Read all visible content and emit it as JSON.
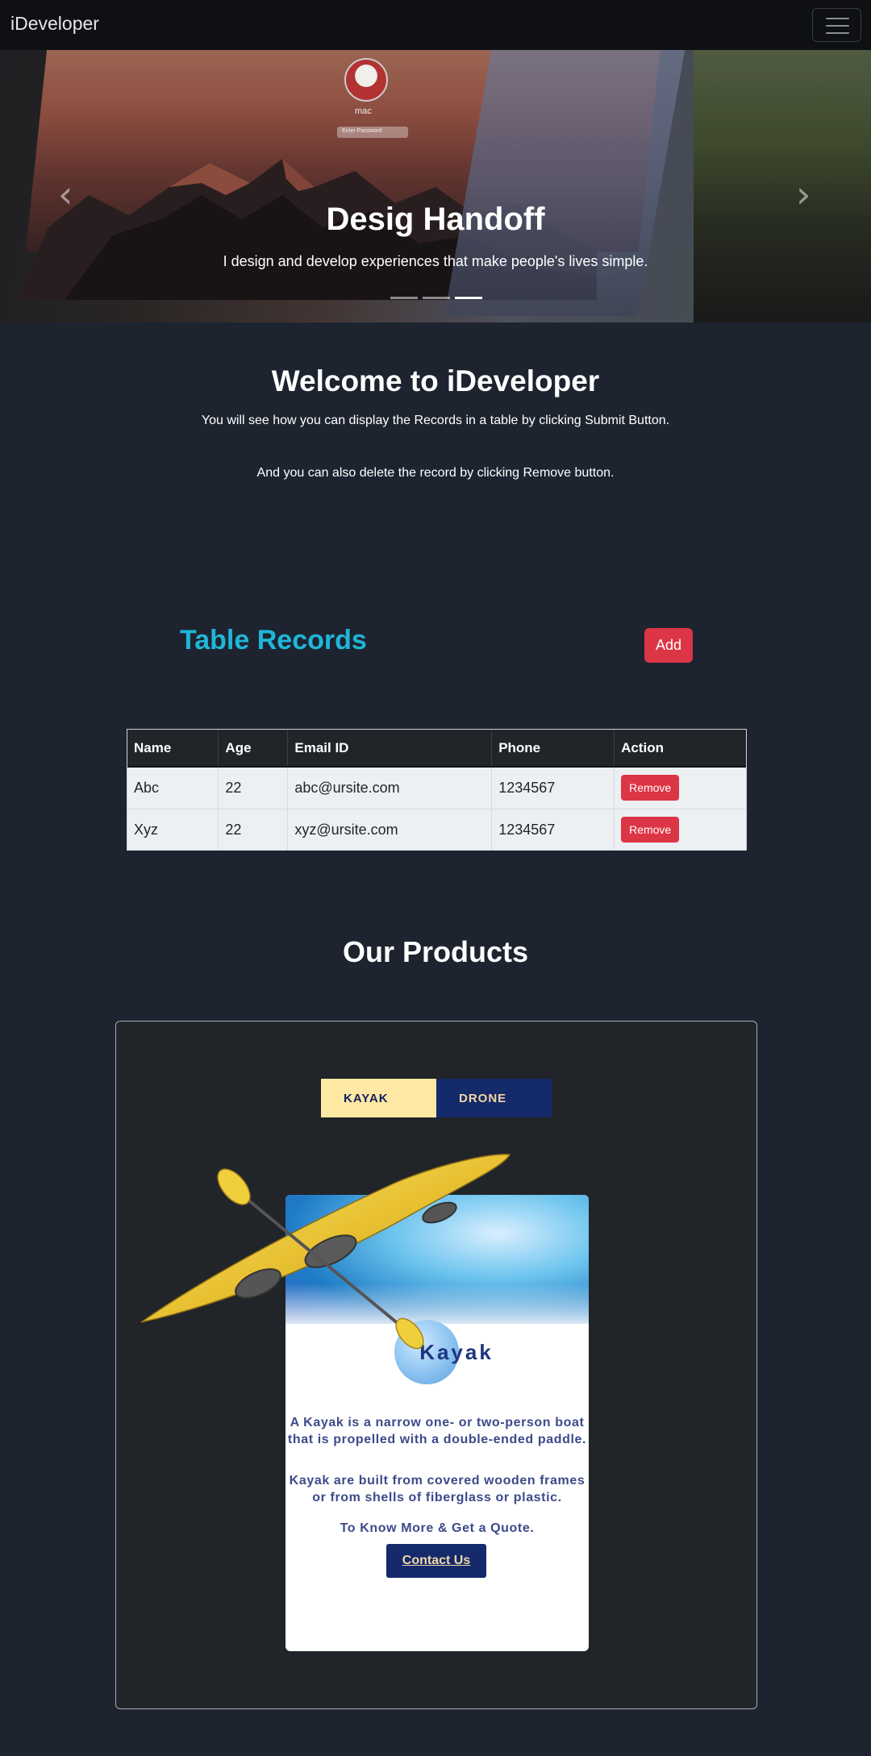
{
  "navbar": {
    "brand": "iDeveloper",
    "menu_icon": "hamburger-menu-icon"
  },
  "hero": {
    "login_name": "mac",
    "login_placeholder": "Enter Password",
    "title": "Desig Handoff",
    "text": "I design and develop experiences that make people's lives simple.",
    "prev_icon": "chevron-left-icon",
    "next_icon": "chevron-right-icon",
    "slide_count": 3,
    "active_slide": 3
  },
  "welcome": {
    "title": "Welcome to iDeveloper",
    "line1": "You will see how you can display the Records in a table by clicking Submit Button.",
    "line2": "And you can also delete the record by clicking Remove button."
  },
  "records": {
    "title": "Table Records",
    "add_label": "Add",
    "columns": [
      "Name",
      "Age",
      "Email ID",
      "Phone",
      "Action"
    ],
    "rows": [
      {
        "name": "Abc",
        "age": "22",
        "email": "abc@ursite.com",
        "phone": "1234567",
        "action": "Remove"
      },
      {
        "name": "Xyz",
        "age": "22",
        "email": "xyz@ursite.com",
        "phone": "1234567",
        "action": "Remove"
      }
    ]
  },
  "products": {
    "title": "Our Products",
    "tabs": [
      {
        "label": "KAYAK",
        "active": true
      },
      {
        "label": "DRONE",
        "active": false
      }
    ],
    "card": {
      "name": "Kayak",
      "desc1": "A Kayak is a narrow one- or two-person boat that is propelled with a double-ended paddle.",
      "desc2": "Kayak are built from covered wooden frames or from shells of fiberglass or plastic.",
      "cta_text": "To Know More & Get a Quote.",
      "button_label": "Contact Us"
    }
  },
  "colors": {
    "page_bg": "#1d2430",
    "navbar_bg": "#0e1013",
    "accent_cyan": "#1fb6d8",
    "danger_red": "#dc3545",
    "tab_active_bg": "#ffe8a3",
    "navy": "#142a6b"
  }
}
